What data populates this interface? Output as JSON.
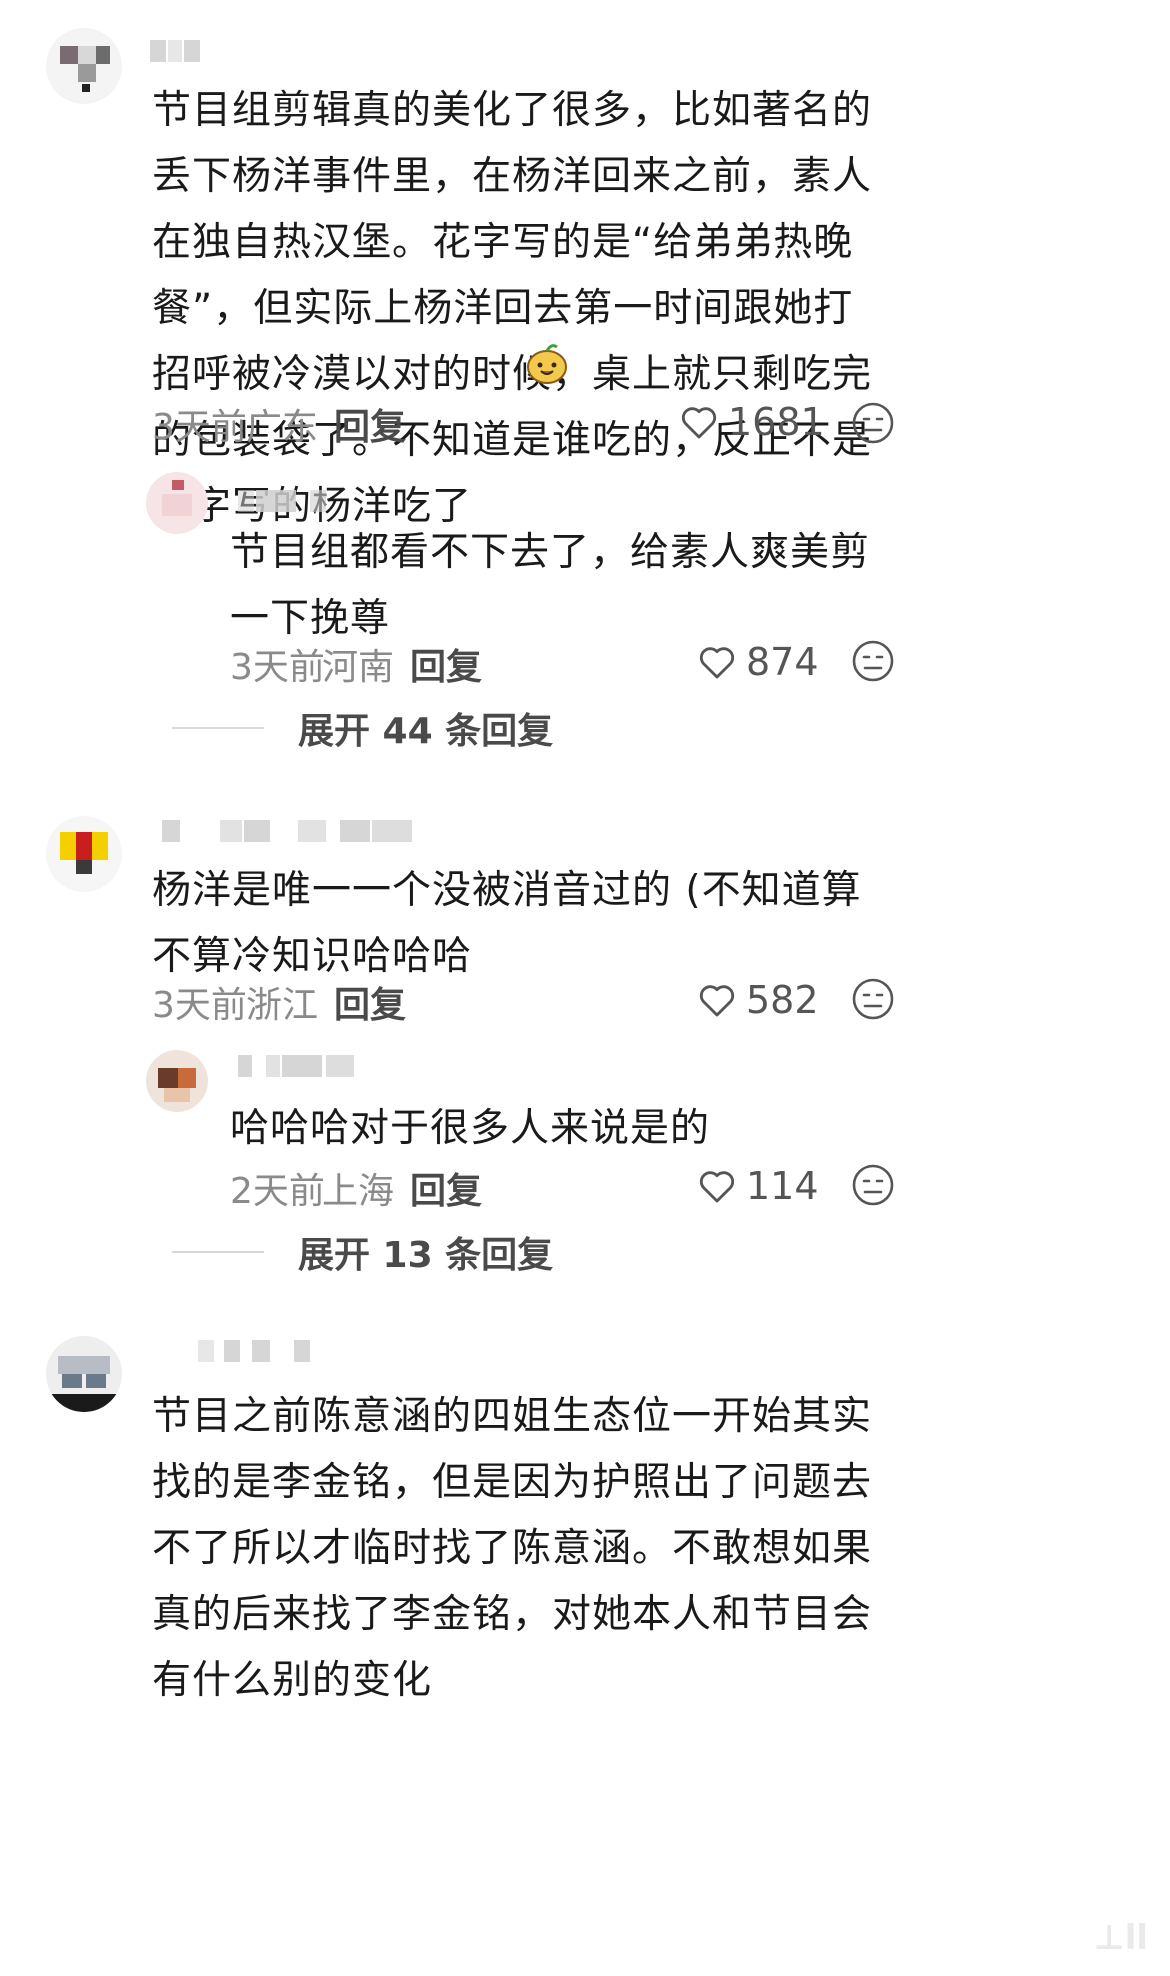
{
  "comments": [
    {
      "text": "节目组剪辑真的美化了很多，比如著名的丢下杨洋事件里，在杨洋回来之前，素人在独自热汉堡。花字写的是“给弟弟热晚餐”，但实际上杨洋回去第一时间跟她打招呼被冷漠以对的时候，桌上就只剩吃完的包装袋了。不知道是谁吃的，反正不是花字写的杨洋吃了",
      "time": "3天前",
      "location": "广东",
      "reply_label": "回复",
      "likes": "1681",
      "emoji_icon": "grinning-bean-emoji"
    },
    {
      "text": "节目组都看不下去了，给素人爽美剪一下挽尊",
      "time": "3天前",
      "location": "河南",
      "reply_label": "回复",
      "likes": "874"
    },
    {
      "text": "杨洋是唯一一个没被消音过的 (不知道算不算冷知识哈哈哈",
      "time": "3天前",
      "location": "浙江",
      "reply_label": "回复",
      "likes": "582"
    },
    {
      "text": "哈哈哈对于很多人来说是的",
      "time": "2天前",
      "location": "上海",
      "reply_label": "回复",
      "likes": "114"
    },
    {
      "text": "节目之前陈意涵的四姐生态位一开始其实找的是李金铭，但是因为护照出了问题去不了所以才临时找了陈意涵。不敢想如果真的后来找了李金铭，对她本人和节目会有什么别的变化"
    }
  ],
  "expand_replies": [
    {
      "label": "展开 44 条回复"
    },
    {
      "label": "展开 13 条回复"
    }
  ],
  "colors": {
    "text": "#1a1a1a",
    "meta": "#8a8a8a",
    "reply": "#4a4a4a",
    "background": "#ffffff"
  },
  "icons": {
    "like": "heart-outline-icon",
    "dislike": "meh-face-icon"
  }
}
